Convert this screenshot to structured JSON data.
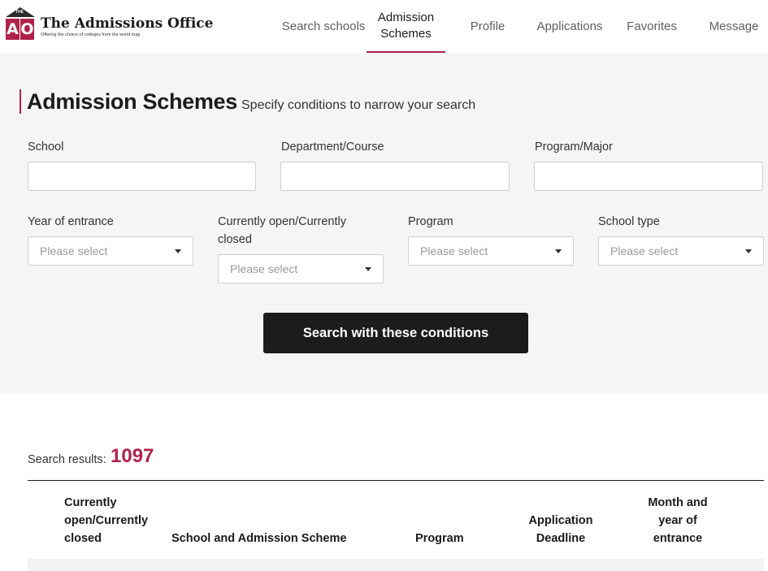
{
  "brand": {
    "logo_letters": [
      "A",
      "O"
    ],
    "logo_small": "THE",
    "name": "The Admissions Office",
    "tagline": "Offering the choice of colleges from the world map",
    "accent_color": "#b0224a"
  },
  "nav": {
    "search_schools": "Search schools",
    "admission_schemes_1": "Admission",
    "admission_schemes_2": "Schemes",
    "profile": "Profile",
    "applications": "Applications",
    "favorites": "Favorites",
    "message": "Message"
  },
  "page": {
    "title": "Admission Schemes",
    "subtitle": "Specify conditions to narrow your search"
  },
  "form": {
    "school_label": "School",
    "department_label": "Department/Course",
    "program_major_label": "Program/Major",
    "year_label": "Year of entrance",
    "open_closed_label": "Currently open/Currently closed",
    "program_label": "Program",
    "school_type_label": "School type",
    "select_placeholder": "Please select",
    "search_button": "Search with these conditions"
  },
  "results": {
    "label": "Search results:",
    "count": "1097",
    "columns": {
      "status_1": "Currently",
      "status_2": "open/Currently",
      "status_3": "closed",
      "school": "School and Admission Scheme",
      "program": "Program",
      "deadline_1": "Application",
      "deadline_2": "Deadline",
      "entrance_1": "Month and",
      "entrance_2": "year of",
      "entrance_3": "entrance"
    }
  }
}
